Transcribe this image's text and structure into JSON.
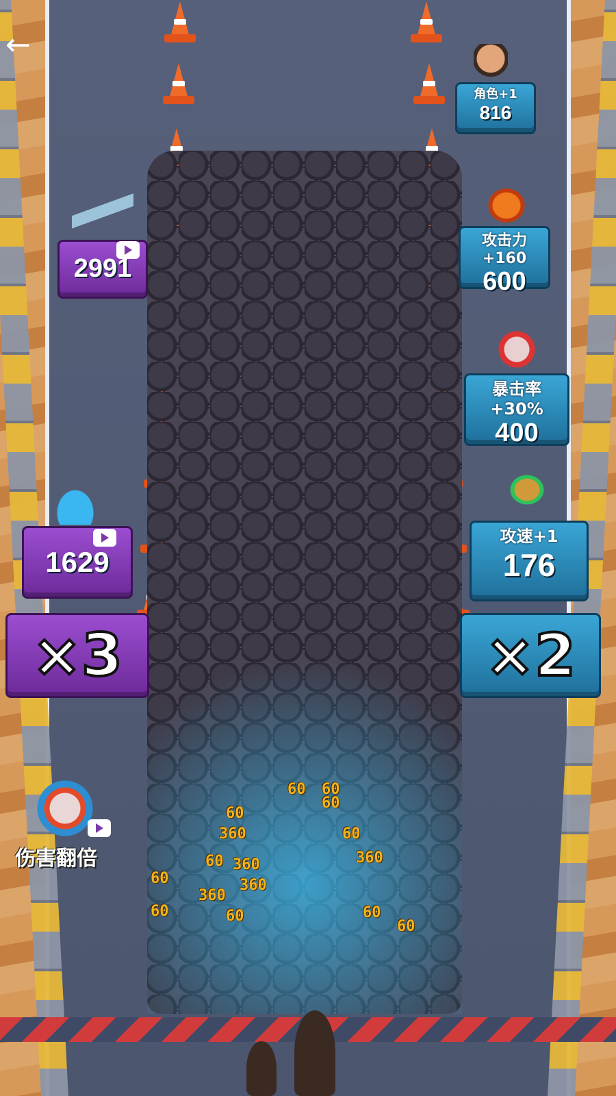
{
  "nav": {
    "back_icon": "←"
  },
  "gates": {
    "character": {
      "label": "角色+1",
      "value": "816",
      "icon": "character-portrait-icon"
    },
    "attack": {
      "label": "攻击力+160",
      "value": "600",
      "icon": "bullet-attack-icon"
    },
    "crit": {
      "label": "暴击率+30%",
      "value": "400",
      "icon": "pistol-crit-icon"
    },
    "speed": {
      "label": "攻速+1",
      "value": "176",
      "icon": "bullet-speed-icon"
    },
    "rocket": {
      "value": "2991",
      "icon": "rocket-weapon-icon"
    },
    "bow": {
      "value": "1629",
      "icon": "bow-weapon-icon"
    }
  },
  "multipliers": {
    "left": "×3",
    "right": "×2"
  },
  "powerup": {
    "label": "伤害翻倍",
    "icon": "pistol-damage-icon"
  },
  "damage_numbers": [
    "60",
    "60",
    "60",
    "60",
    "360",
    "60",
    "60",
    "360",
    "60",
    "360",
    "360",
    "360",
    "60",
    "60",
    "60",
    "60"
  ],
  "colors": {
    "blue_gate": "#2a8fc4",
    "purple_gate": "#8a3fc0",
    "damage_text": "#f2b21b"
  }
}
